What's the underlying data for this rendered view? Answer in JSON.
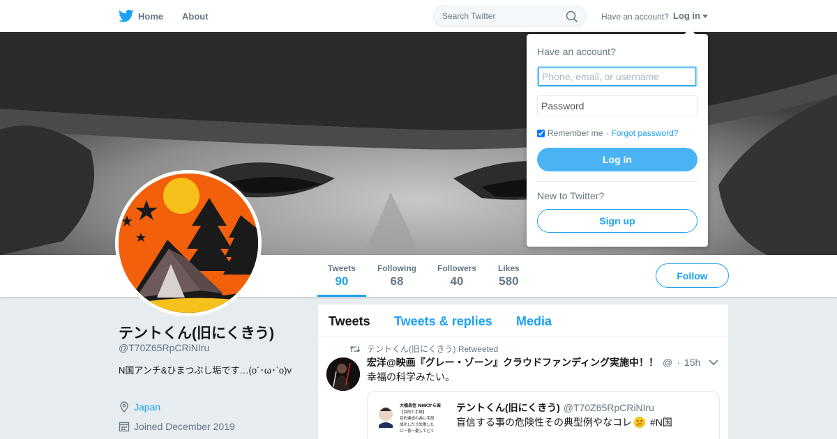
{
  "topnav": {
    "home_label": "Home",
    "about_label": "About",
    "search_placeholder": "Search Twitter",
    "have_account": "Have an account?",
    "login_label": "Log in"
  },
  "stats": [
    {
      "label": "Tweets",
      "value": "90"
    },
    {
      "label": "Following",
      "value": "68"
    },
    {
      "label": "Followers",
      "value": "40"
    },
    {
      "label": "Likes",
      "value": "580"
    }
  ],
  "follow_label": "Follow",
  "profile": {
    "name": "テントくん(旧にくきう)",
    "handle": "@T70Z65RpCRiNIru",
    "bio": "N国アンチ&ひまつぶし垢です…(o´･ω･`o)v",
    "location": "Japan",
    "joined": "Joined December 2019"
  },
  "tabs": [
    {
      "label": "Tweets"
    },
    {
      "label": "Tweets & replies"
    },
    {
      "label": "Media"
    }
  ],
  "tweet": {
    "retweet_note": "テントくん(旧にくきう) Retweeted",
    "author": "宏洋@映画『グレー・ゾーン』クラウドファンディング実施中！！",
    "handle": "@",
    "separator": "·",
    "time": "15h",
    "text": "幸福の科学みたい。",
    "quote": {
      "author": "テントくん(旧にくきう)",
      "handle": "@T70Z65RpCRiNIru",
      "text": "盲信する事の危険性その典型例やなコレ",
      "hashtag": "#N国",
      "media_lines": [
        "大橋昌信 NHKから国",
        "【目的と手段】",
        "目的達成の為に手段",
        "成功したり失敗した",
        "に一喜一憂してどう"
      ]
    }
  },
  "dropdown": {
    "title": "Have an account?",
    "username_placeholder": "Phone, email, or username",
    "password_placeholder": "Password",
    "remember": "Remember me",
    "separator": "·",
    "forgot": "Forgot password?",
    "login_button": "Log in",
    "new_to": "New to Twitter?",
    "signup_button": "Sign up"
  },
  "colors": {
    "accent": "#1da1f2",
    "login_button": "#4ab3f4",
    "avatar_bg": "#f2600c"
  },
  "icons": {
    "logo": "twitter-bird-icon",
    "search": "search-icon",
    "location": "location-pin-icon",
    "calendar": "calendar-icon",
    "retweet": "retweet-icon",
    "menu": "chevron-down-icon"
  }
}
